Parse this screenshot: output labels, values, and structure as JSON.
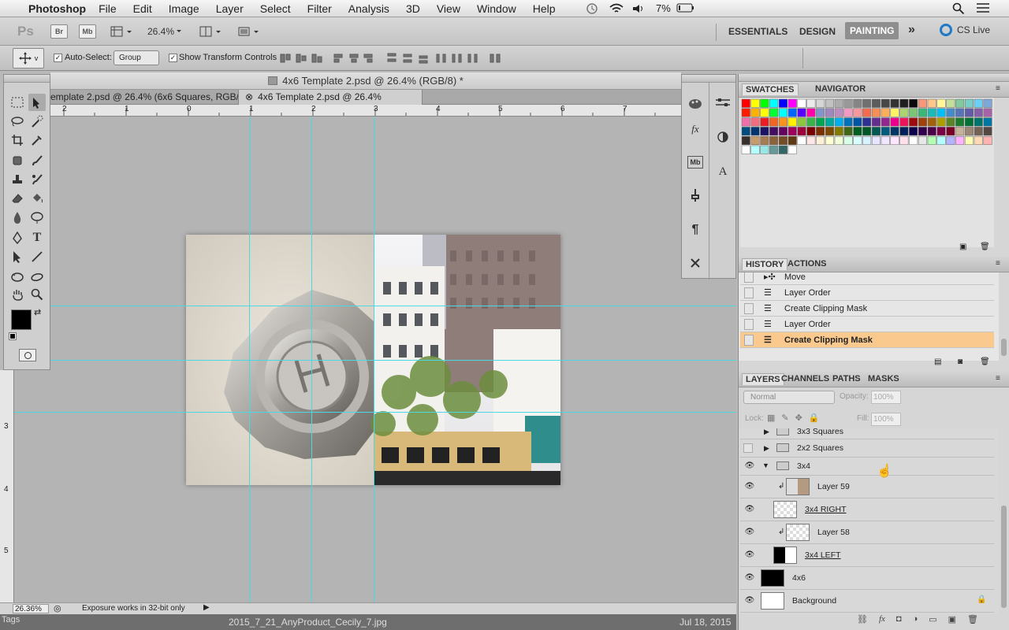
{
  "menubar": {
    "app": "Photoshop",
    "items": [
      "File",
      "Edit",
      "Image",
      "Layer",
      "Select",
      "Filter",
      "Analysis",
      "3D",
      "View",
      "Window",
      "Help"
    ],
    "battery": "7%"
  },
  "optionsbar": {
    "ps": "Ps",
    "br": "Br",
    "mb": "Mb",
    "zoom": "26.4%",
    "workspaces": [
      "ESSENTIALS",
      "DESIGN",
      "PAINTING"
    ],
    "active_workspace": "PAINTING",
    "cslive": "CS Live",
    "autoselect_label": "Auto-Select:",
    "autoselect_value": "Group",
    "transform_label": "Show Transform Controls",
    "move_v": "v"
  },
  "document": {
    "title": "4x6 Template 2.psd @ 26.4% (RGB/8) *",
    "tabs": [
      "emplate 2.psd @ 26.4% (6x6 Squares, RGB/8)",
      "4x6 Template 2.psd @ 26.4% (RGB/8) *"
    ],
    "ruler_h": [
      "2",
      "1",
      "0",
      "1",
      "2",
      "3",
      "4",
      "5",
      "6",
      "7"
    ],
    "ruler_v": [
      "3",
      "4",
      "5"
    ]
  },
  "statusbar": {
    "zoom": "26.36%",
    "message": "Exposure works in 32-bit only"
  },
  "dock": {
    "filename": "2015_7_21_AnyProduct_Cecily_7.jpg",
    "date": "Jul 18, 2015",
    "left": "Tags"
  },
  "swatches_panel": {
    "tabs": [
      "SWATCHES",
      "NAVIGATOR"
    ]
  },
  "history_panel": {
    "tabs": [
      "HISTORY",
      "ACTIONS"
    ],
    "items": [
      "Move",
      "Layer Order",
      "Create Clipping Mask",
      "Layer Order",
      "Create Clipping Mask"
    ],
    "active_index": 4
  },
  "layers_panel": {
    "tabs": [
      "LAYERS",
      "CHANNELS",
      "PATHS",
      "MASKS"
    ],
    "blend_mode": "Normal",
    "opacity_label": "Opacity:",
    "opacity": "100%",
    "lock_label": "Lock:",
    "fill_label": "Fill:",
    "fill": "100%",
    "layers": [
      "3x3 Squares",
      "2x2 Squares",
      "3x4",
      "Layer 59",
      "3x4 RIGHT",
      "Layer 58",
      "3x4 LEFT",
      "4x6",
      "Background"
    ]
  },
  "colors": {
    "accent_history": "#f9c98e",
    "guide": "#4ad9e4"
  }
}
